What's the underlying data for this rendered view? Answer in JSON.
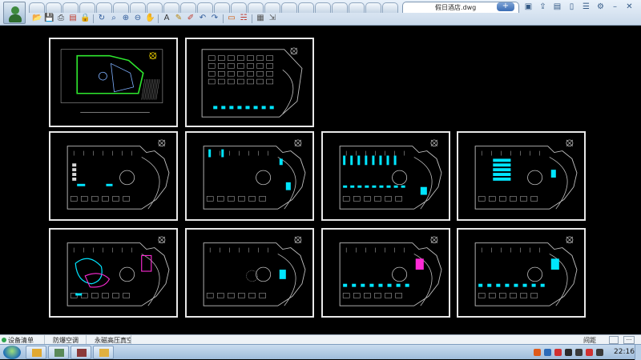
{
  "window": {
    "active_tab_label": "假日酒店.dwg",
    "close_glyph": "✕",
    "new_tab_glyph": "+",
    "inactive_tab_count": 22
  },
  "top_icons": [
    {
      "name": "picture-icon",
      "glyph": "▣"
    },
    {
      "name": "share-icon",
      "glyph": "⇪"
    },
    {
      "name": "folder-icon",
      "glyph": "▤"
    },
    {
      "name": "phone-icon",
      "glyph": "▯"
    },
    {
      "name": "menu-icon",
      "glyph": "☰"
    },
    {
      "name": "gear-icon",
      "glyph": "⚙"
    },
    {
      "name": "minimize-icon",
      "glyph": "–"
    },
    {
      "name": "close-icon",
      "glyph": "✕"
    }
  ],
  "toolbar": [
    {
      "name": "open-icon",
      "glyph": "📂",
      "color": "#c99a2e"
    },
    {
      "name": "save-icon",
      "glyph": "💾",
      "color": "#2e5a9a"
    },
    {
      "name": "print-icon",
      "glyph": "⎙",
      "color": "#333333"
    },
    {
      "name": "pdf-icon",
      "glyph": "▤",
      "color": "#c0392b"
    },
    {
      "name": "lock-icon",
      "glyph": "🔒",
      "color": "#d4a017"
    },
    {
      "name": "rotate-icon",
      "glyph": "↻",
      "color": "#2e5a9a"
    },
    {
      "name": "zoom-icon",
      "glyph": "⌕",
      "color": "#2e5a9a"
    },
    {
      "name": "zoom-window-icon",
      "glyph": "⊕",
      "color": "#2e5a9a"
    },
    {
      "name": "zoom-out-icon",
      "glyph": "⊖",
      "color": "#2e5a9a"
    },
    {
      "name": "pan-icon",
      "glyph": "✋",
      "color": "#2e5a9a"
    },
    {
      "name": "text-icon",
      "glyph": "A",
      "color": "#333333"
    },
    {
      "name": "pencil-icon",
      "glyph": "✎",
      "color": "#b8860b"
    },
    {
      "name": "brush-icon",
      "glyph": "✐",
      "color": "#c0392b"
    },
    {
      "name": "undo-icon",
      "glyph": "↶",
      "color": "#2e5a9a"
    },
    {
      "name": "redo-icon",
      "glyph": "↷",
      "color": "#2e5a9a"
    },
    {
      "name": "measure-icon",
      "glyph": "▭",
      "color": "#d35400"
    },
    {
      "name": "dimension-icon",
      "glyph": "☵",
      "color": "#c0392b"
    },
    {
      "name": "layers-icon",
      "glyph": "▦",
      "color": "#555555"
    },
    {
      "name": "export-icon",
      "glyph": "⇲",
      "color": "#555555"
    }
  ],
  "bottom_tabs": [
    {
      "label": "设备清单",
      "active": true
    },
    {
      "label": "防爆空调"
    },
    {
      "label": "永磁高压真空..."
    }
  ],
  "status": {
    "zoom_label": "间距",
    "btn_glyph": "···"
  },
  "taskbar": {
    "tasks": [
      {
        "name": "explorer-task",
        "color": "#e0a830"
      },
      {
        "name": "avatar-task",
        "color": "#5a8a5a"
      },
      {
        "name": "books-task",
        "color": "#8b3a3a"
      },
      {
        "name": "folder-task",
        "color": "#e0b040"
      }
    ],
    "tray": [
      {
        "name": "ime-icon",
        "color": "#e05a1a"
      },
      {
        "name": "help-icon",
        "color": "#2a6ab8"
      },
      {
        "name": "shield-icon",
        "color": "#d03030"
      },
      {
        "name": "chat-icon",
        "color": "#2a2a2a"
      },
      {
        "name": "network-icon",
        "color": "#3a3a3a"
      },
      {
        "name": "flag-icon",
        "color": "#d03030"
      },
      {
        "name": "volume-icon",
        "color": "#3a3a3a"
      }
    ],
    "clock": "22:16"
  },
  "colors": {
    "drawing_bg": "#000000",
    "sheet_border": "#e8e8e8",
    "cad_line": "#bfbfbf",
    "cyan": "#00e5ff",
    "magenta": "#ff2bd6",
    "green": "#2ee82e",
    "yellow": "#ffe000"
  },
  "sheets": [
    {
      "name": "sheet-site-plan",
      "kind": "site"
    },
    {
      "name": "sheet-ground-floor",
      "kind": "ground"
    },
    {
      "name": "sheet-basement-1",
      "kind": "plan-a"
    },
    {
      "name": "sheet-floor-2",
      "kind": "plan-b"
    },
    {
      "name": "sheet-floor-3",
      "kind": "plan-c"
    },
    {
      "name": "sheet-floor-4",
      "kind": "plan-d"
    },
    {
      "name": "sheet-floor-5",
      "kind": "plan-e"
    },
    {
      "name": "sheet-floor-6",
      "kind": "plan-f"
    },
    {
      "name": "sheet-floor-7",
      "kind": "plan-g"
    },
    {
      "name": "sheet-floor-8",
      "kind": "plan-h"
    }
  ]
}
